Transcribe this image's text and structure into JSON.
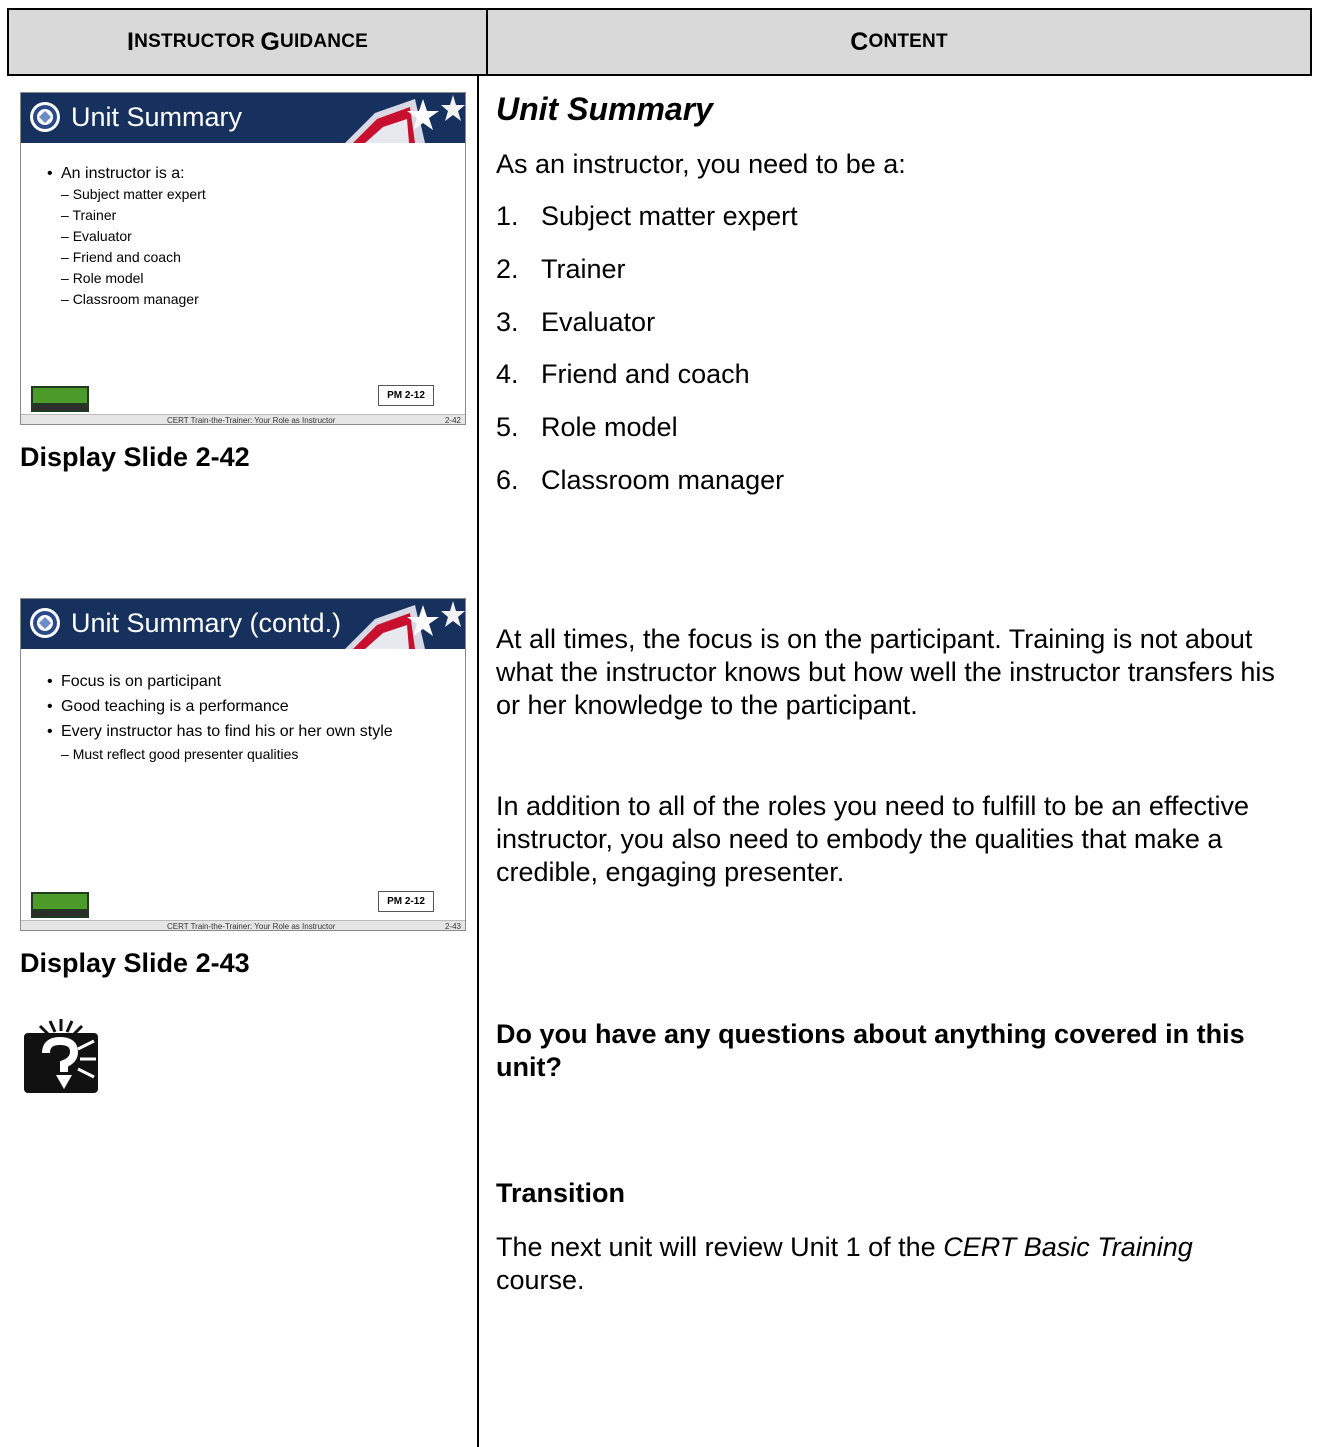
{
  "header": {
    "left": {
      "first": "I",
      "rest": "nstructor ",
      "first2": "G",
      "rest2": "uidance"
    },
    "right": {
      "first": "C",
      "rest": "ontent"
    }
  },
  "slides": [
    {
      "title": "Unit Summary",
      "bullets": [
        {
          "level": 1,
          "text": "An instructor is a:"
        },
        {
          "level": 2,
          "text": "Subject matter expert"
        },
        {
          "level": 2,
          "text": "Trainer"
        },
        {
          "level": 2,
          "text": "Evaluator"
        },
        {
          "level": 2,
          "text": "Friend and coach"
        },
        {
          "level": 2,
          "text": "Role model"
        },
        {
          "level": 2,
          "text": "Classroom manager"
        }
      ],
      "pm": "PM 2-12",
      "footer": "CERT Train-the-Trainer: Your Role as Instructor",
      "number": "2-42",
      "caption": "Display Slide 2-42"
    },
    {
      "title": "Unit Summary (contd.)",
      "bullets": [
        {
          "level": 1,
          "text": "Focus is on participant"
        },
        {
          "level": 1,
          "text": "Good teaching is a performance"
        },
        {
          "level": 1,
          "text": "Every instructor has to find his or her own style"
        },
        {
          "level": 2,
          "text": "Must reflect good presenter qualities"
        }
      ],
      "pm": "PM 2-12",
      "footer": "CERT Train-the-Trainer: Your Role as Instructor",
      "number": "2-43",
      "caption": "Display Slide 2-43"
    }
  ],
  "question_icon": "question-mark-icon",
  "content": {
    "heading": "Unit Summary",
    "intro": "As an instructor, you need to be a:",
    "list": [
      {
        "n": "1.",
        "text": "Subject matter expert"
      },
      {
        "n": "2.",
        "text": "Trainer"
      },
      {
        "n": "3.",
        "text": "Evaluator"
      },
      {
        "n": "4.",
        "text": "Friend and coach"
      },
      {
        "n": "5.",
        "text": "Role model"
      },
      {
        "n": "6.",
        "text": "Classroom manager"
      }
    ],
    "para1": "At all times, the focus is on the participant.  Training is not about what the instructor knows but how well the instructor transfers his or her knowledge to the participant.",
    "para2": "In addition to all of the roles you need to fulfill to be an effective instructor, you also need to embody the qualities that make a credible, engaging presenter.",
    "question": "Do you have any questions about anything covered in this unit?",
    "transition_heading": "Transition",
    "transition": {
      "before": "The next unit will review Unit 1 of the ",
      "italic": "CERT Basic Training",
      "after": " course."
    }
  }
}
